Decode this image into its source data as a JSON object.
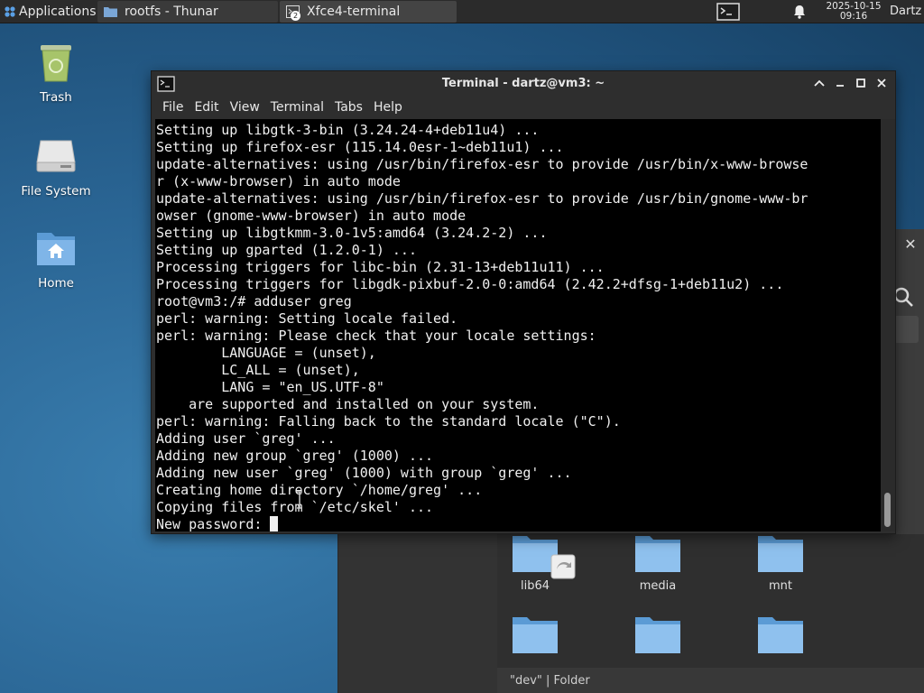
{
  "panel": {
    "applications_label": "Applications ☰",
    "tasks": [
      {
        "label": "rootfs - Thunar"
      },
      {
        "label": "Xfce4-terminal",
        "badge": "2"
      }
    ],
    "clock_date": "2025-10-15",
    "clock_time": "09:16",
    "user": "Dartz"
  },
  "desktop": {
    "icons": [
      {
        "label": "Trash"
      },
      {
        "label": "File System"
      },
      {
        "label": "Home"
      }
    ]
  },
  "thunar": {
    "folders": [
      {
        "label": "lib64"
      },
      {
        "label": "media"
      },
      {
        "label": "mnt"
      },
      {
        "label": ""
      },
      {
        "label": ""
      },
      {
        "label": ""
      }
    ],
    "status": "\"dev\"  |  Folder",
    "close_glyph": "✕"
  },
  "terminal": {
    "title": "Terminal - dartz@vm3: ~",
    "menu": [
      "File",
      "Edit",
      "View",
      "Terminal",
      "Tabs",
      "Help"
    ],
    "lines": [
      "Setting up libgtk-3-bin (3.24.24-4+deb11u4) ...",
      "Setting up firefox-esr (115.14.0esr-1~deb11u1) ...",
      "update-alternatives: using /usr/bin/firefox-esr to provide /usr/bin/x-www-browse",
      "r (x-www-browser) in auto mode",
      "update-alternatives: using /usr/bin/firefox-esr to provide /usr/bin/gnome-www-br",
      "owser (gnome-www-browser) in auto mode",
      "Setting up libgtkmm-3.0-1v5:amd64 (3.24.2-2) ...",
      "Setting up gparted (1.2.0-1) ...",
      "Processing triggers for libc-bin (2.31-13+deb11u11) ...",
      "Processing triggers for libgdk-pixbuf-2.0-0:amd64 (2.42.2+dfsg-1+deb11u2) ...",
      "root@vm3:/# adduser greg",
      "perl: warning: Setting locale failed.",
      "perl: warning: Please check that your locale settings:",
      "        LANGUAGE = (unset),",
      "        LC_ALL = (unset),",
      "        LANG = \"en_US.UTF-8\"",
      "    are supported and installed on your system.",
      "perl: warning: Falling back to the standard locale (\"C\").",
      "Adding user `greg' ...",
      "Adding new group `greg' (1000) ...",
      "Adding new user `greg' (1000) with group `greg' ...",
      "Creating home directory `/home/greg' ...",
      "Copying files from `/etc/skel' ..."
    ],
    "prompt": "New password: "
  }
}
